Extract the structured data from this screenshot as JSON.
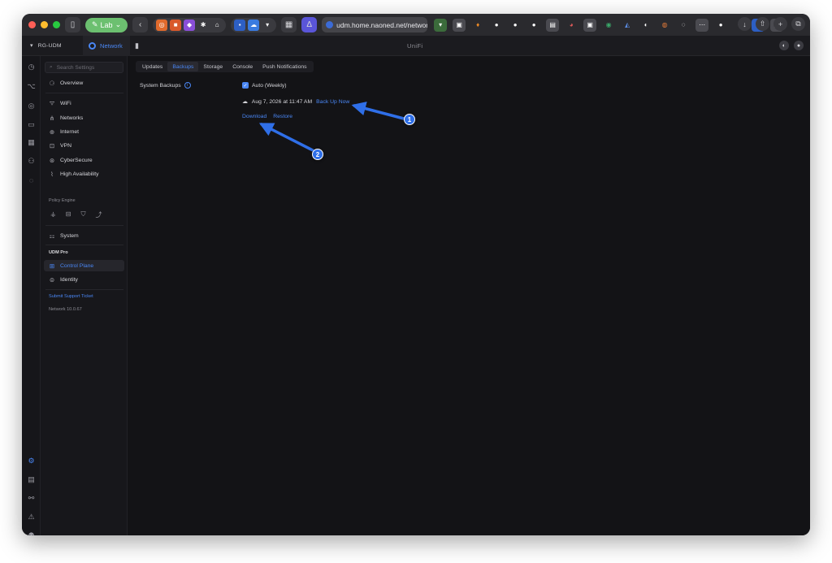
{
  "browser": {
    "lab_label": "Lab",
    "url": "udm.home.naoned.net/network/c"
  },
  "app": {
    "console_name": "RG-UDM",
    "active_app": "Network",
    "brand": "UniFi"
  },
  "settings": {
    "search_placeholder": "Search Settings",
    "nav": [
      {
        "label": "Overview"
      },
      {
        "label": "WiFi"
      },
      {
        "label": "Networks"
      },
      {
        "label": "Internet"
      },
      {
        "label": "VPN"
      },
      {
        "label": "CyberSecure"
      },
      {
        "label": "High Availability"
      }
    ],
    "policy_engine_label": "Policy Engine",
    "system_label": "System",
    "device_heading": "UDM Pro",
    "control_plane_label": "Control Plane",
    "identity_label": "Identity",
    "support_link": "Submit Support Ticket",
    "version": "Network 10.0.67"
  },
  "content": {
    "tabs": [
      "Updates",
      "Backups",
      "Storage",
      "Console",
      "Push Notifications"
    ],
    "active_tab": "Backups",
    "system_backups_label": "System Backups",
    "auto_label": "Auto (Weekly)",
    "auto_checked": true,
    "last_backup": "Aug 7, 2026 at 11:47 AM",
    "back_up_now": "Back Up Now",
    "download": "Download",
    "restore": "Restore"
  },
  "annotations": [
    {
      "number": "1",
      "target": "Back Up Now"
    },
    {
      "number": "2",
      "target": "Download"
    }
  ],
  "colors": {
    "accent": "#4a87f5",
    "annotation": "#2f6fe8",
    "background": "#131316"
  }
}
